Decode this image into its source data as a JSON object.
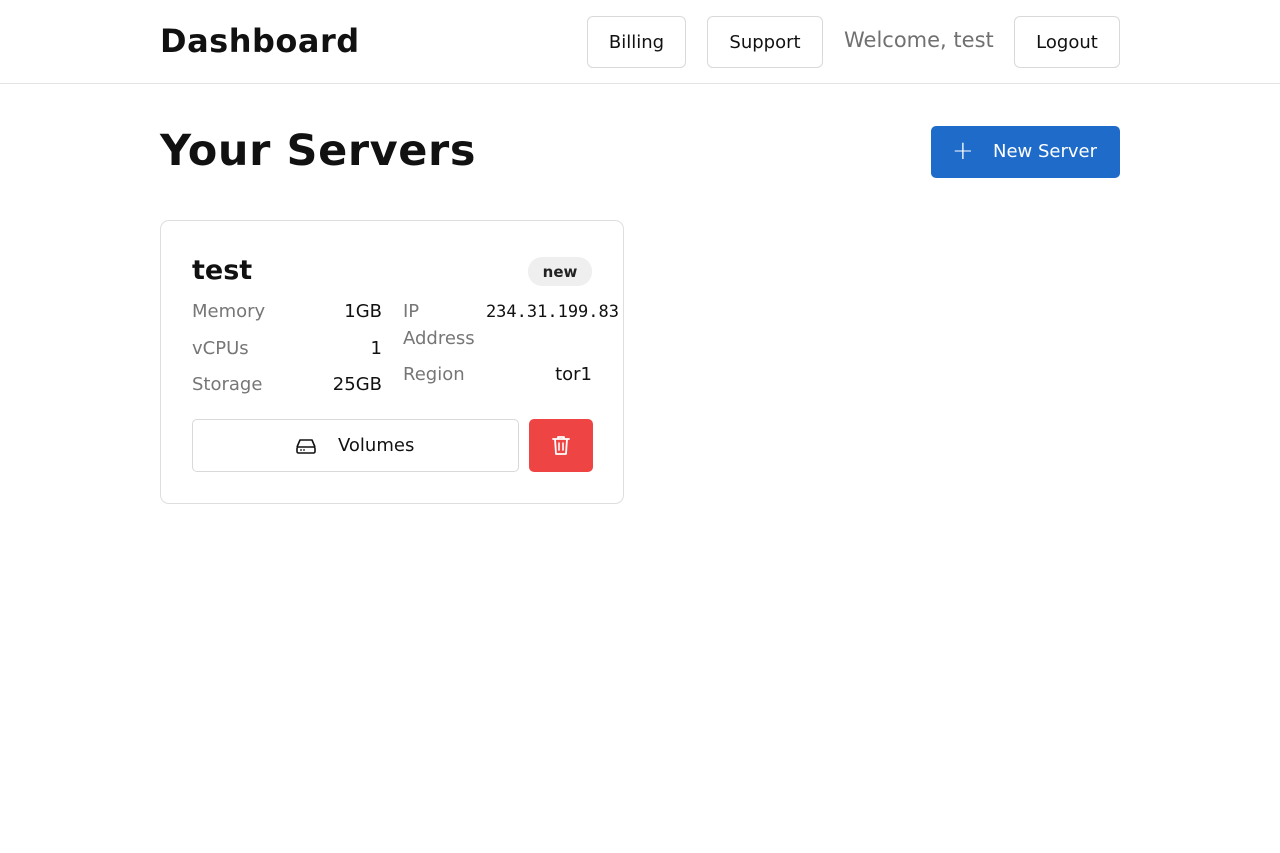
{
  "header": {
    "title": "Dashboard",
    "nav": {
      "billing": "Billing",
      "support": "Support",
      "logout": "Logout"
    },
    "welcome": "Welcome, test"
  },
  "main": {
    "title": "Your Servers",
    "new_server": {
      "label": "New Server",
      "icon": "plus-icon"
    }
  },
  "servers": [
    {
      "name": "test",
      "status": "new",
      "specs": {
        "memory": {
          "label": "Memory",
          "value": "1GB"
        },
        "vcpus": {
          "label": "vCPUs",
          "value": "1"
        },
        "storage": {
          "label": "Storage",
          "value": "25GB"
        },
        "ip": {
          "label_line1": "IP",
          "label_line2": "Address",
          "value": "234.31.199.83"
        },
        "region": {
          "label": "Region",
          "value": "tor1"
        }
      },
      "volumes_button": {
        "label": "Volumes",
        "icon": "hard-drive-icon"
      },
      "delete_button": {
        "icon": "trash-icon"
      }
    }
  ],
  "colors": {
    "primary": "#1e6bc9",
    "danger": "#ef4444",
    "muted_text": "#767676",
    "border": "#dedede"
  }
}
